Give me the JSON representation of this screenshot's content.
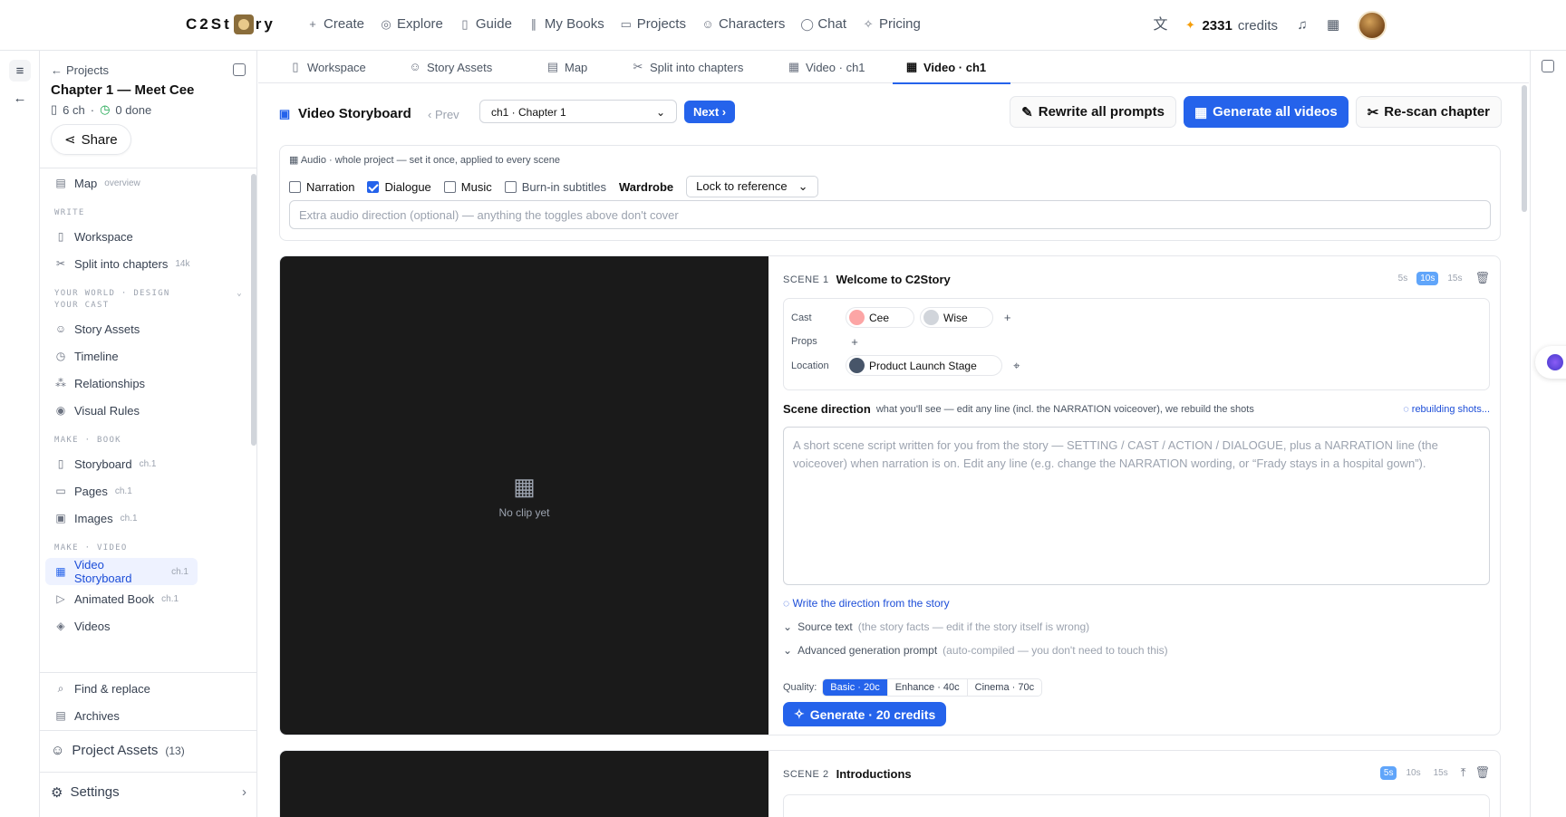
{
  "brand": {
    "logo_left": "C2St",
    "logo_right": "ry"
  },
  "nav": [
    {
      "label": "Create",
      "icon": "+"
    },
    {
      "label": "Explore",
      "icon": "◎"
    },
    {
      "label": "Guide",
      "icon": "▯"
    },
    {
      "label": "My Books",
      "icon": "∥"
    },
    {
      "label": "Projects",
      "icon": "▭"
    },
    {
      "label": "Characters",
      "icon": "☺"
    },
    {
      "label": "Chat",
      "icon": "◯"
    },
    {
      "label": "Pricing",
      "icon": "✧"
    }
  ],
  "credits": {
    "value": "2331",
    "label": "credits"
  },
  "sidebar": {
    "crumb": "Projects",
    "title": "Chapter 1 — Meet Cee",
    "chapters": "6 ch",
    "done": "0 done",
    "share": "Share",
    "map": {
      "label": "Map",
      "tag": "overview"
    },
    "sections": {
      "write": "WRITE",
      "world": "YOUR WORLD · DESIGN YOUR CAST",
      "book": "MAKE · BOOK",
      "video": "MAKE · VIDEO"
    },
    "write_items": [
      {
        "label": "Workspace",
        "tag": ""
      },
      {
        "label": "Split into chapters",
        "tag": "14k"
      }
    ],
    "world_items": [
      {
        "label": "Story Assets"
      },
      {
        "label": "Timeline"
      },
      {
        "label": "Relationships"
      },
      {
        "label": "Visual Rules"
      }
    ],
    "book_items": [
      {
        "label": "Storyboard",
        "tag": "ch.1"
      },
      {
        "label": "Pages",
        "tag": "ch.1"
      },
      {
        "label": "Images",
        "tag": "ch.1"
      }
    ],
    "video_items": [
      {
        "label": "Video Storyboard",
        "tag": "ch.1"
      },
      {
        "label": "Animated Book",
        "tag": "ch.1"
      },
      {
        "label": "Videos",
        "tag": ""
      }
    ],
    "footer_items": [
      {
        "label": "Find & replace"
      },
      {
        "label": "Archives"
      }
    ],
    "project_assets": "Project Assets",
    "project_assets_count": "(13)",
    "settings": "Settings"
  },
  "tabs": [
    {
      "label": "Workspace"
    },
    {
      "label": "Story Assets"
    },
    {
      "label": "Map"
    },
    {
      "label": "Split into chapters"
    },
    {
      "label": "Video · ch1"
    },
    {
      "label": "Video · ch1"
    }
  ],
  "toolbar": {
    "title": "Video Storyboard",
    "prev": "Prev",
    "chapter_select": "ch1 · Chapter 1",
    "next": "Next",
    "rewrite": "Rewrite all prompts",
    "generate_all": "Generate all videos",
    "rescan": "Re-scan chapter"
  },
  "audio": {
    "header": "Audio · whole project — set it once, applied to every scene",
    "narration": "Narration",
    "dialogue": "Dialogue",
    "music": "Music",
    "subtitles": "Burn-in subtitles",
    "wardrobe_label": "Wardrobe",
    "wardrobe_value": "Lock to reference",
    "direction_placeholder": "Extra audio direction (optional) — anything the toggles above don't cover"
  },
  "scene1": {
    "label": "SCENE 1",
    "title": "Welcome to C2Story",
    "durations": [
      "5s",
      "10s",
      "15s"
    ],
    "no_clip": "No clip yet",
    "cast_label": "Cast",
    "cast": [
      "Cee",
      "Wise"
    ],
    "props_label": "Props",
    "location_label": "Location",
    "location": "Product Launch Stage",
    "direction_title": "Scene direction",
    "direction_sub": "what you'll see — edit any line (incl. the NARRATION voiceover), we rebuild the shots",
    "rebuilding": "rebuilding shots...",
    "direction_placeholder": "A short scene script written for you from the story — SETTING / CAST / ACTION / DIALOGUE, plus a NARRATION line (the voiceover) when narration is on. Edit any line (e.g. change the NARRATION wording, or “Frady stays in a hospital gown”).",
    "write_direction": "Write the direction from the story",
    "source_text": "Source text",
    "source_text_note": "(the story facts — edit if the story itself is wrong)",
    "advanced": "Advanced generation prompt",
    "advanced_note": "(auto-compiled — you don't need to touch this)",
    "quality_label": "Quality:",
    "quality": [
      "Basic · 20c",
      "Enhance · 40c",
      "Cinema · 70c"
    ],
    "generate": "Generate · 20 credits"
  },
  "scene2": {
    "label": "SCENE 2",
    "title": "Introductions",
    "durations": [
      "5s",
      "10s",
      "15s"
    ]
  }
}
